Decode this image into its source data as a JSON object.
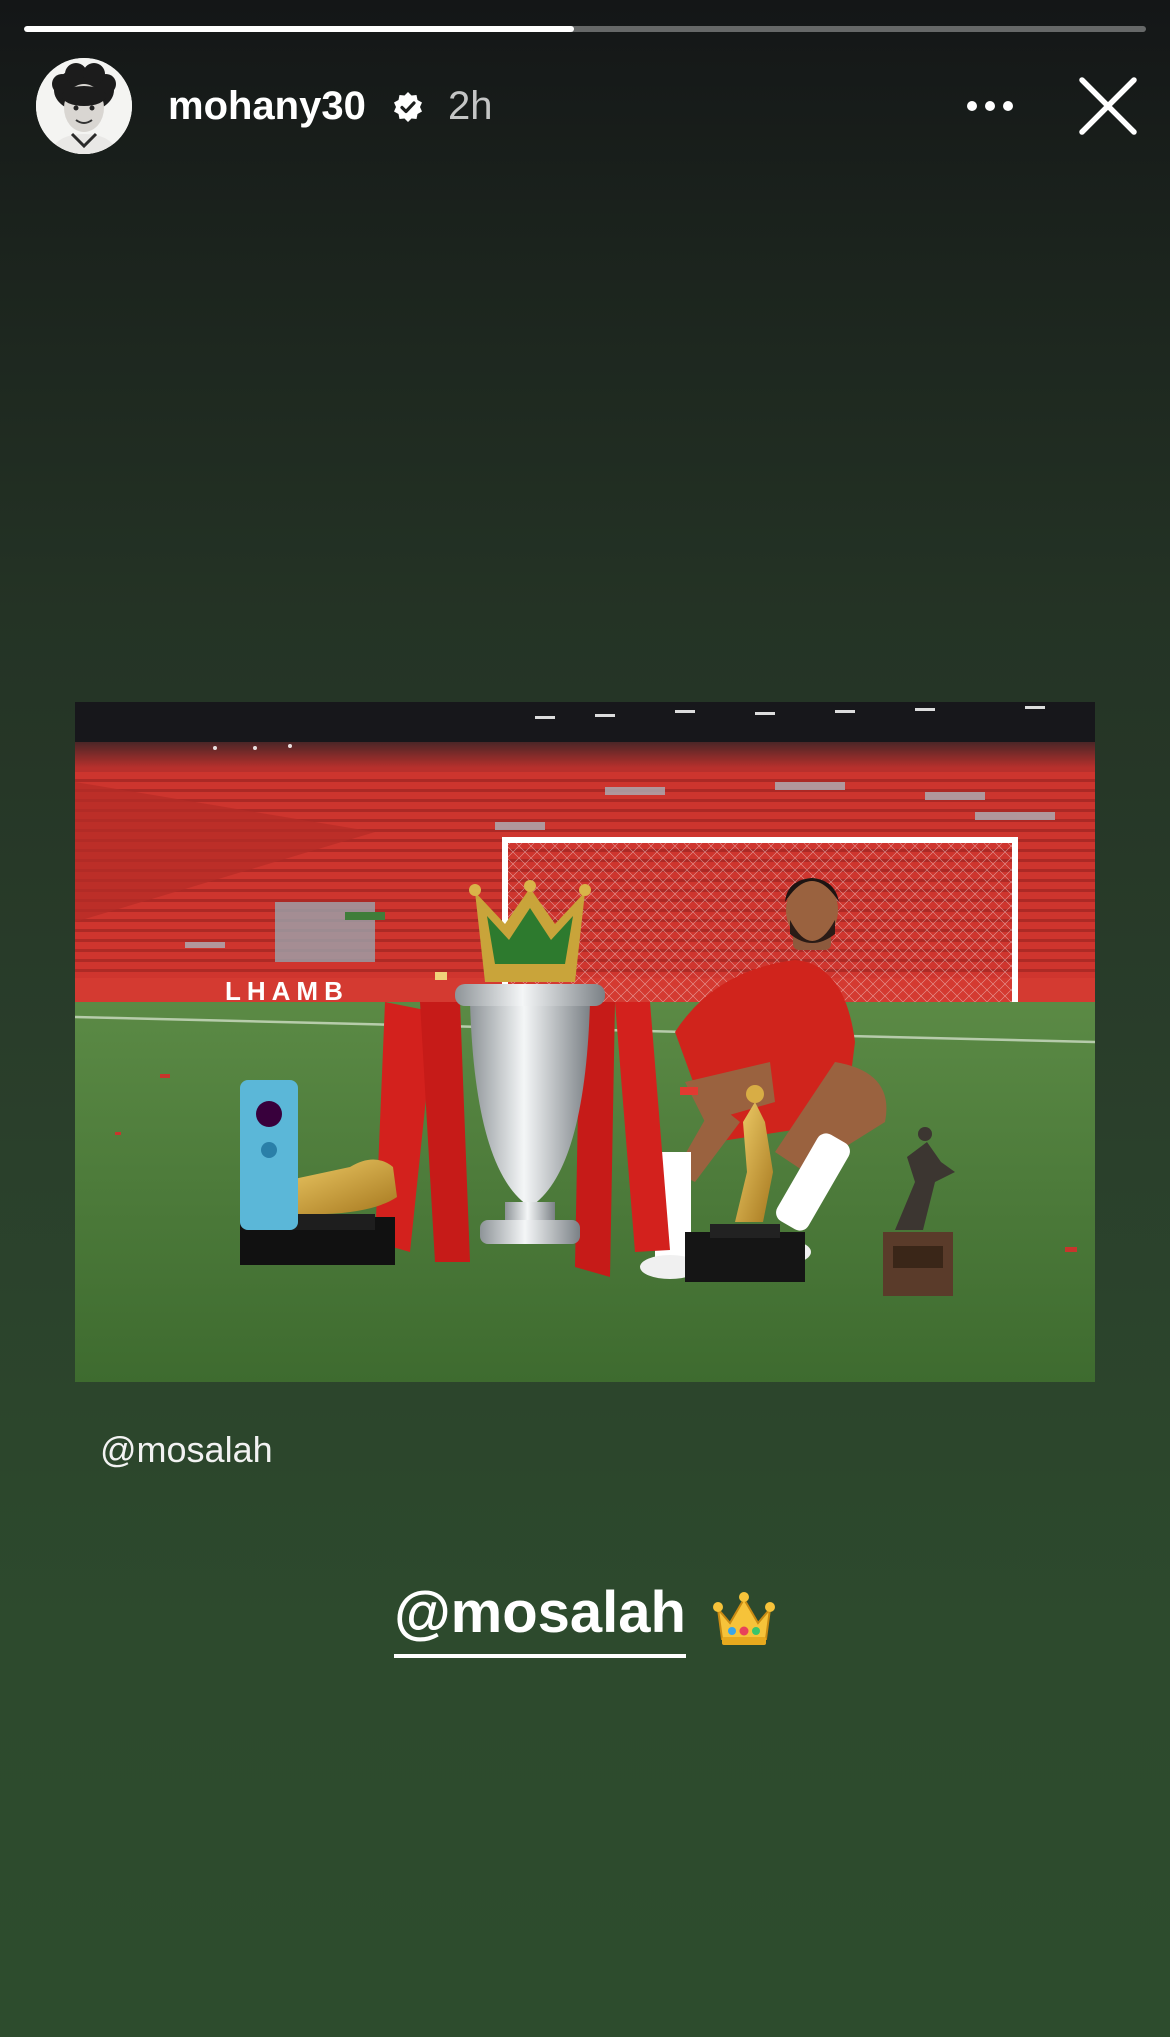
{
  "story": {
    "progress": 0.49,
    "username": "mohany30",
    "verified": true,
    "time": "2h",
    "icons": {
      "verified": "verified-badge-icon",
      "more": "more-horizontal-icon",
      "close": "close-icon",
      "crown": "crown-emoji-icon"
    }
  },
  "shared_post": {
    "credit": "@mosalah"
  },
  "sticker": {
    "mention": "@mosalah"
  },
  "colors": {
    "background_top": "#141617",
    "background_bottom": "#2d4c2d",
    "text": "#ffffff"
  }
}
